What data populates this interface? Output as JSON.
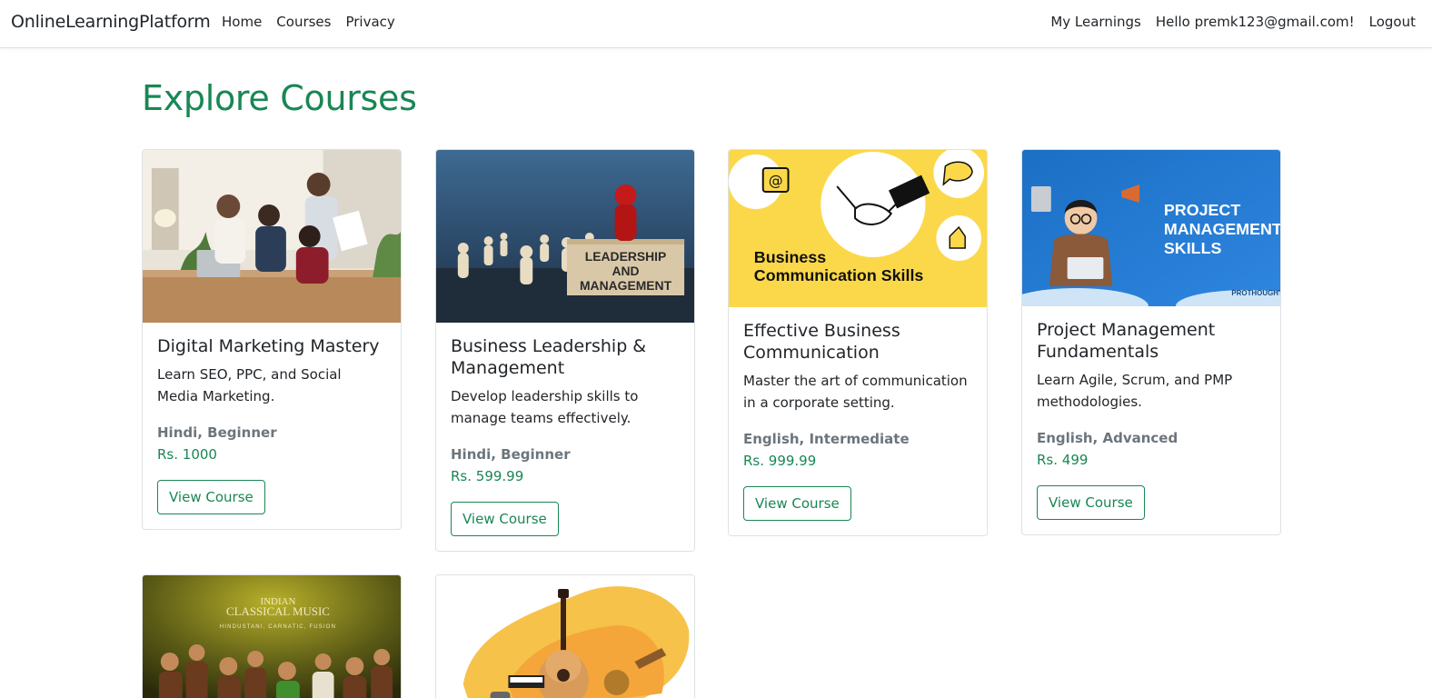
{
  "navbar": {
    "brand": "OnlineLearningPlatform",
    "left_links": [
      "Home",
      "Courses",
      "Privacy"
    ],
    "right_links": [
      "My Learnings",
      "Hello premk123@gmail.com!",
      "Logout"
    ]
  },
  "page": {
    "title": "Explore Courses"
  },
  "courses": [
    {
      "title": "Digital Marketing Mastery",
      "description": "Learn SEO, PPC, and Social Media Marketing.",
      "meta": "Hindi, Beginner",
      "price": "Rs. 1000",
      "button": "View Course",
      "image_text": ""
    },
    {
      "title": "Business Leadership & Management",
      "description": "Develop leadership skills to manage teams effectively.",
      "meta": "Hindi, Beginner",
      "price": "Rs. 599.99",
      "button": "View Course",
      "image_text": "LEADERSHIP AND MANAGEMENT"
    },
    {
      "title": "Effective Business Communication",
      "description": "Master the art of communication in a corporate setting.",
      "meta": "English, Intermediate",
      "price": "Rs. 999.99",
      "button": "View Course",
      "image_text": "Business Communication Skills"
    },
    {
      "title": "Project Management Fundamentals",
      "description": "Learn Agile, Scrum, and PMP methodologies.",
      "meta": "English, Advanced",
      "price": "Rs. 499",
      "button": "View Course",
      "image_text": "PROJECT MANAGEMENT SKILLS"
    },
    {
      "image_text": "INDIAN CLASSICAL MUSIC",
      "image_subtext": "HINDUSTANI, CARNATIC, FUSION"
    },
    {
      "image_text": ""
    }
  ],
  "colors": {
    "accent": "#198754",
    "muted": "#6c757d"
  }
}
